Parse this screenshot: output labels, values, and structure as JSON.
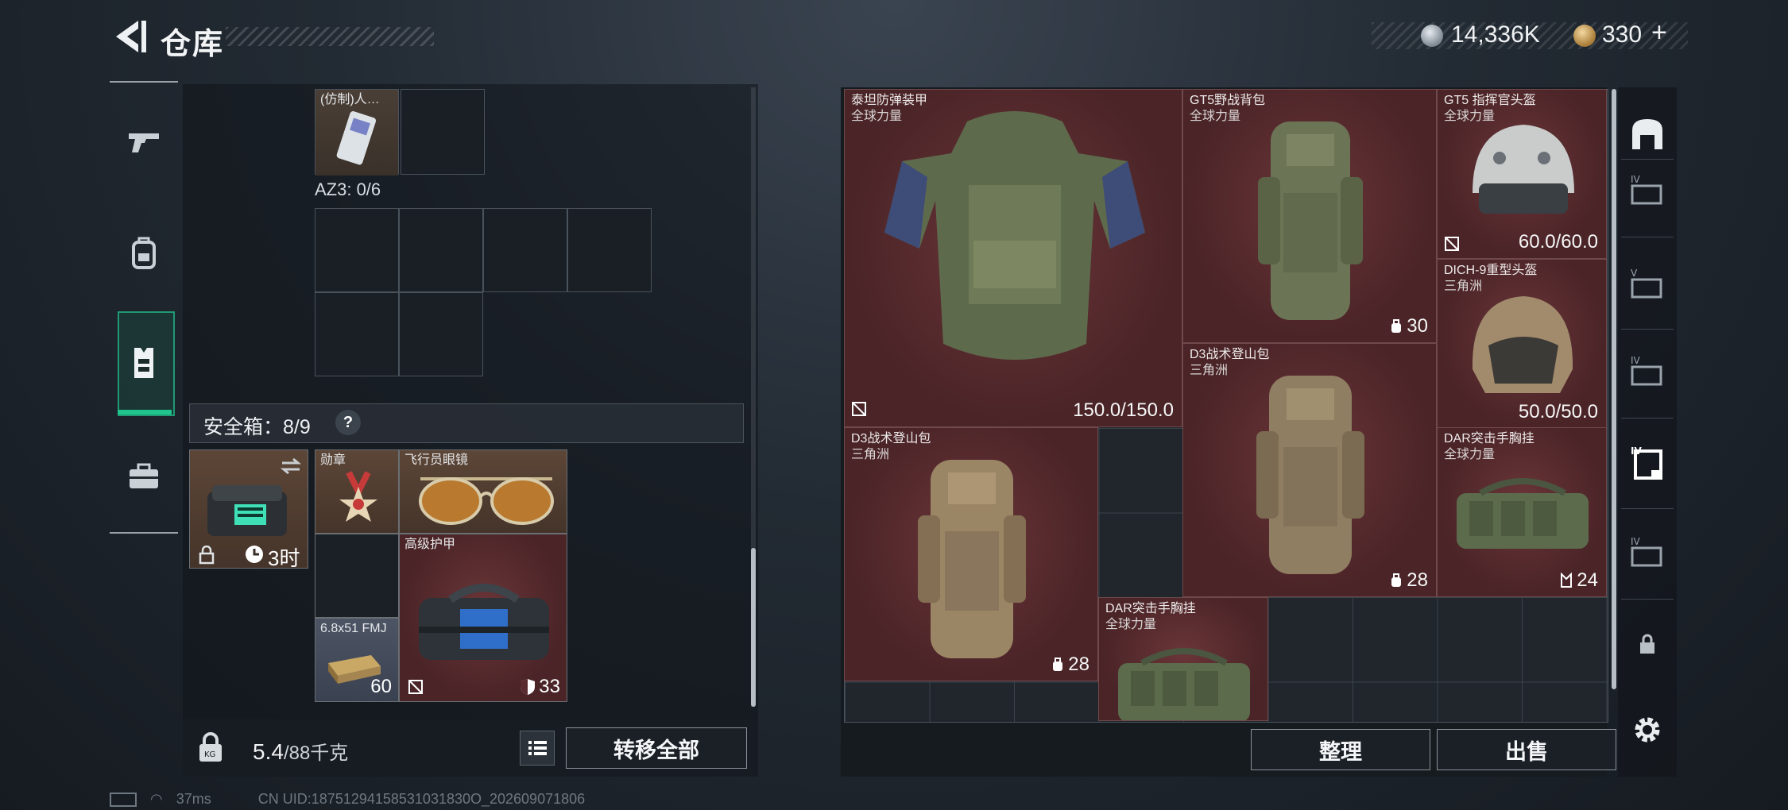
{
  "header": {
    "title": "仓库",
    "currency": [
      {
        "name": "silver-coin",
        "value": "14,336K"
      },
      {
        "name": "gold-coin",
        "value": "330"
      }
    ],
    "add_symbol": "+"
  },
  "left_nav": {
    "items": [
      "gun-icon",
      "backpack-icon",
      "vest-icon",
      "toolbox-icon"
    ],
    "active_index": 2
  },
  "left_panel": {
    "top_item_label": "(仿制)人…",
    "az3_label": "AZ3: 0/6",
    "safe_box_label": "安全箱：8/9",
    "safe_box_help": "?",
    "secure_container": {
      "timer": "3时",
      "icons": [
        "swap-icon",
        "lock-icon",
        "clock-icon"
      ]
    },
    "items": [
      {
        "name": "勋章",
        "type": "medal"
      },
      {
        "name": "飞行员眼镜",
        "type": "sunglasses"
      },
      {
        "name": "高级护甲",
        "type": "armor-bag",
        "value": "33"
      },
      {
        "name": "6.8x51 FMJ",
        "type": "ammo",
        "value": "60"
      }
    ]
  },
  "footer_left": {
    "weight_value": "5.4",
    "weight_max": "/88千克",
    "transfer_all_button": "转移全部"
  },
  "right_panel": {
    "items": [
      {
        "name": "泰坦防弹装甲",
        "sub": "全球力量",
        "value": "150.0/150.0"
      },
      {
        "name": "GT5野战背包",
        "sub": "全球力量",
        "value": "30"
      },
      {
        "name": "GT5 指挥官头盔",
        "sub": "全球力量",
        "value": "60.0/60.0"
      },
      {
        "name": "DICH-9重型头盔",
        "sub": "三角洲",
        "value": "50.0/50.0"
      },
      {
        "name": "D3战术登山包",
        "sub": "三角洲",
        "value": "28"
      },
      {
        "name": "D3战术登山包",
        "sub": "三角洲",
        "value": "28"
      },
      {
        "name": "DAR突击手胸挂",
        "sub": "全球力量",
        "value": "24"
      },
      {
        "name": "DAR突击手胸挂",
        "sub": "全球力量",
        "value": ""
      }
    ],
    "organize_button": "整理",
    "sell_button": "出售"
  },
  "right_nav": {
    "items": [
      "home-icon",
      "stash-IV-1",
      "stash-V",
      "stash-IV-2",
      "stash-IV-active",
      "stash-IV-3",
      "lock-icon",
      "settings-icon"
    ]
  },
  "status_bar": {
    "ping": "37ms",
    "uid": "CN UID:18751294158531031830O_202609071806"
  },
  "colors": {
    "accent_green": "#1fc48f",
    "item_red": "#5a2c2f",
    "text": "#e8ecef"
  }
}
